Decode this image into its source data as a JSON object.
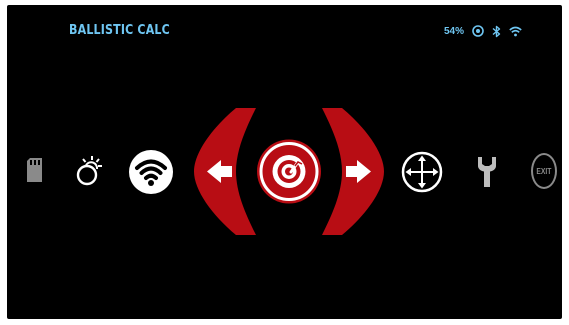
{
  "header": {
    "title": "BALLISTIC CALC",
    "battery": "54%",
    "status_icons": [
      "compass-icon",
      "bluetooth-icon",
      "wifi-icon"
    ]
  },
  "menu": {
    "items": [
      {
        "name": "sd-card-icon",
        "label": ""
      },
      {
        "name": "weather-icon",
        "label": ""
      },
      {
        "name": "wifi-icon",
        "label": ""
      },
      {
        "name": "ballistic-calc-icon",
        "label": "",
        "selected": true
      },
      {
        "name": "crosshair-icon",
        "label": ""
      },
      {
        "name": "wrench-icon",
        "label": ""
      },
      {
        "name": "exit-icon",
        "label": "EXIT"
      }
    ],
    "nav_prev": "left-arrow-icon",
    "nav_next": "right-arrow-icon"
  },
  "colors": {
    "accent_red": "#b80d14",
    "title_blue": "#6fc6f2",
    "background": "#000000"
  }
}
